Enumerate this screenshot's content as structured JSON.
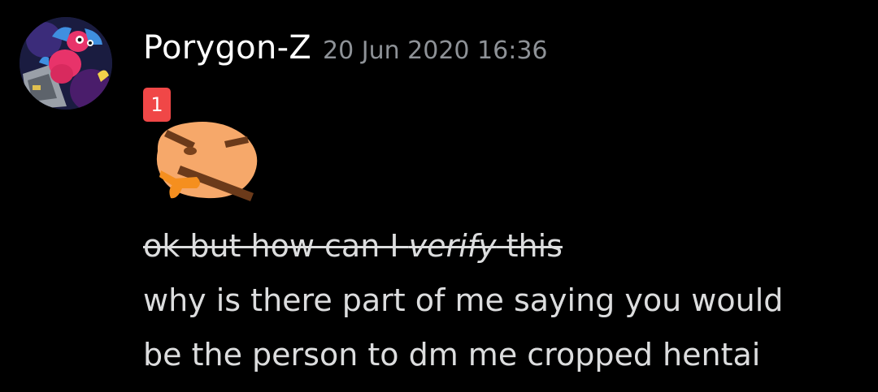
{
  "message": {
    "author": "Porygon-Z",
    "timestamp": "20 Jun 2020 16:36",
    "reaction": {
      "count": "1",
      "emoji": "thinking-angry-face-emoji",
      "badge_color": "#f04747"
    },
    "lines": [
      {
        "strikethrough": true,
        "segments": [
          {
            "text": "ok but how can I ",
            "italic": false
          },
          {
            "text": "verify",
            "italic": true
          },
          {
            "text": " this",
            "italic": false
          }
        ]
      },
      {
        "text": "why is there part of me saying you would"
      },
      {
        "text": "be the person to dm me cropped hentai"
      }
    ]
  },
  "colors": {
    "background": "#000000",
    "author": "#ffffff",
    "timestamp": "#8e9297",
    "body_text": "#dcddde"
  }
}
